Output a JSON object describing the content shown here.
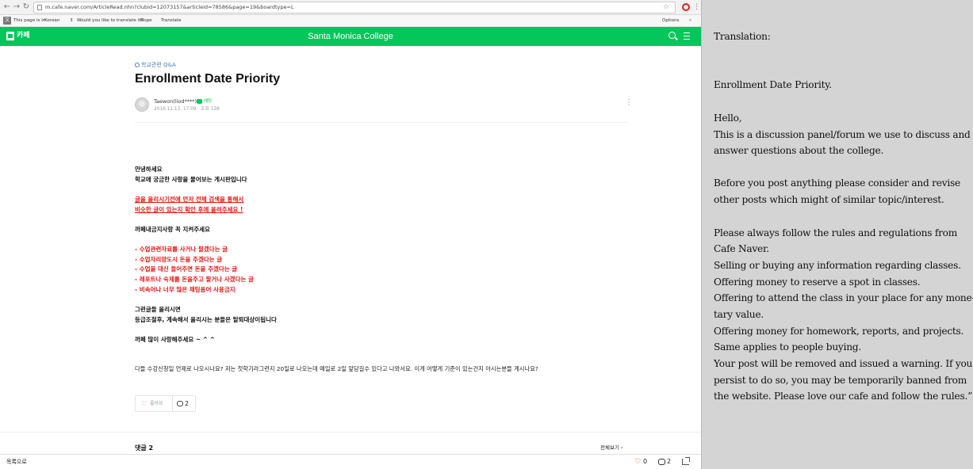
{
  "browser": {
    "url": "m.cafe.naver.com/ArticleRead.nhn?clubid=12073157&articleid=78586&page=19&boardtype=L",
    "translate_bar": {
      "page_is_in": "This page is in",
      "language": "Korean",
      "question": "Would you like to translate it?",
      "nope": "Nope",
      "translate": "Translate",
      "options": "Options",
      "close": "×"
    }
  },
  "app": {
    "cafe_label": "카페",
    "cafe_title": "Santa Monica College"
  },
  "article": {
    "board": "학교관련 Q&A",
    "title": "Enrollment Date Priority",
    "author": "Taewon(liod****)",
    "author_badge": "채팅",
    "date": "2016.11.13. 17:09",
    "views": "조회 128",
    "body": [
      {
        "text": "안녕하세요",
        "style": "bold"
      },
      {
        "text": "학교에 궁금한 사항을 물어보는 게시판입니다",
        "style": "bold"
      },
      {
        "text": "글을 올리시기전에 먼저 전체 검색을 통해서 ",
        "style": "red-underline"
      },
      {
        "text": "비슷한 글이 있는지 확인 후에 올려주세요 !",
        "style": "red-underline"
      },
      {
        "text": "까페내금지사항 꼭 지켜주세요",
        "style": "bold"
      },
      {
        "text": "- 수업관련자료를 사거나 팔겠다는 글",
        "style": "red"
      },
      {
        "text": "- 수업자리양도시 돈을 주겠다는 글",
        "style": "red"
      },
      {
        "text": "- 수업을 대신 들어주면 돈을 주겠다는 글",
        "style": "red"
      },
      {
        "text": "- 레포트나 숙제를 돈을주고 팔거나 사겠다는 글",
        "style": "red"
      },
      {
        "text": "- 비속어나 너무 많은 채팅용어 사용금지",
        "style": "red"
      },
      {
        "text": "그런글들 올리시면",
        "style": "bold"
      },
      {
        "text": "등급조절후, 계속해서 올리시는 분들은 탈퇴대상이됩니다",
        "style": "bold"
      },
      {
        "text": "까페 많이 사랑해주세요 ~ ^ ^",
        "style": "bold"
      },
      {
        "text": "다들 수강신청일 언제로 나오시나요? 저는 첫학기라그런지 20일로 나오는데 메일로 2일 앞당길수 있다고 나와서요. 이게 어떻게 기준이 있는건지 아시는분들 계시나요?",
        "style": "normal"
      }
    ],
    "like_label": "좋아요",
    "comment_count": "2",
    "comments_heading": "댓글 2",
    "view_all": "전체보기 ›"
  },
  "bottom_bar": {
    "back_to_list": "목록으로",
    "like_count": "0",
    "comment_count": "2"
  },
  "translation": {
    "lines": [
      "Translation:",
      "Enrollment Date Priority.",
      "Hello,",
      "This is a discussion panel/forum we use to discuss and",
      "answer questions about the college.",
      "Before you post anything please consider and revise",
      "other posts which might of similar topic/interest.",
      "Please always follow the rules and regulations from",
      "Cafe Naver.",
      "Selling or buying any information regarding classes.",
      "Offering money to reserve a spot in classes.",
      "Offering to attend the class in your place for any mone-",
      "tary value.",
      "Offering money for homework, reports, and projects.",
      "Same applies to people buying.",
      "Your post will be removed and issued a warning. If you",
      "persist to do so, you may be temporarily banned from",
      "the website. Please love our cafe and follow the rules.”"
    ]
  },
  "colors": {
    "brand_green": "#03c75a",
    "warning_red": "#ee1111",
    "panel_gray": "#d4d4d4"
  }
}
